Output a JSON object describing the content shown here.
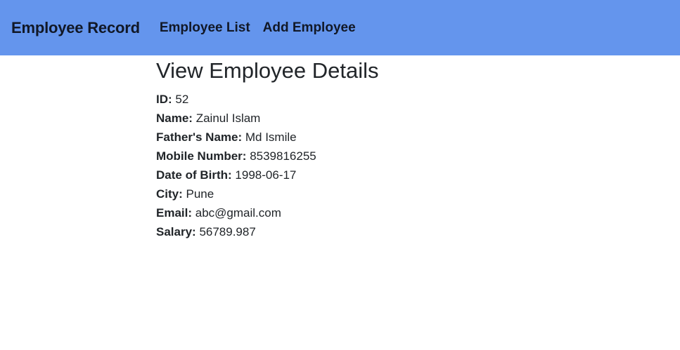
{
  "navbar": {
    "brand": "Employee Record",
    "links": [
      {
        "label": "Employee List"
      },
      {
        "label": "Add Employee"
      }
    ],
    "background": "#6495ed"
  },
  "page": {
    "title": "View Employee Details"
  },
  "details": [
    {
      "label": "ID:",
      "value": "52"
    },
    {
      "label": "Name:",
      "value": "Zainul Islam"
    },
    {
      "label": "Father's Name:",
      "value": "Md Ismile"
    },
    {
      "label": "Mobile Number:",
      "value": "8539816255"
    },
    {
      "label": "Date of Birth:",
      "value": "1998-06-17"
    },
    {
      "label": "City:",
      "value": "Pune"
    },
    {
      "label": "Email:",
      "value": "abc@gmail.com"
    },
    {
      "label": "Salary:",
      "value": "56789.987"
    }
  ]
}
